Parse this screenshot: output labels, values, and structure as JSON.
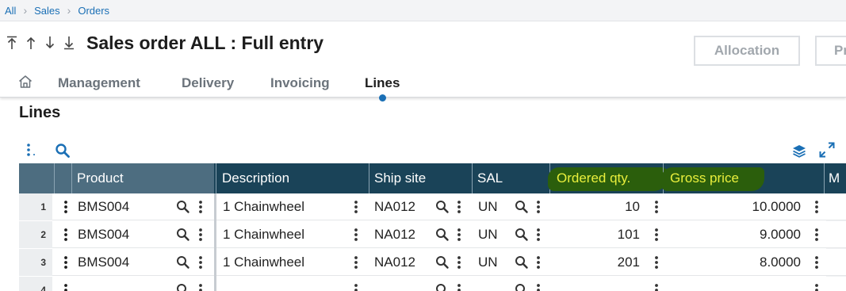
{
  "breadcrumb": [
    "All",
    "Sales",
    "Orders"
  ],
  "title": "Sales order ALL : Full entry",
  "actions": {
    "allocation": "Allocation",
    "next": "Pr"
  },
  "tabs": [
    {
      "label": "Management"
    },
    {
      "label": "Delivery"
    },
    {
      "label": "Invoicing"
    },
    {
      "label": "Lines",
      "active": true
    }
  ],
  "section": {
    "title": "Lines"
  },
  "grid": {
    "columns": {
      "product": "Product",
      "description": "Description",
      "ship_site": "Ship site",
      "sal": "SAL",
      "ordered_qty": "Ordered qty.",
      "gross_price": "Gross price",
      "more": "M"
    },
    "rows": [
      {
        "num": "1",
        "product": "BMS004",
        "description": "1 Chainwheel",
        "ship_site": "NA012",
        "sal": "UN",
        "ordered_qty": "10",
        "gross_price": "10.0000"
      },
      {
        "num": "2",
        "product": "BMS004",
        "description": "1 Chainwheel",
        "ship_site": "NA012",
        "sal": "UN",
        "ordered_qty": "101",
        "gross_price": "9.0000"
      },
      {
        "num": "3",
        "product": "BMS004",
        "description": "1 Chainwheel",
        "ship_site": "NA012",
        "sal": "UN",
        "ordered_qty": "201",
        "gross_price": "8.0000"
      },
      {
        "num": "4",
        "product": "",
        "description": "",
        "ship_site": "",
        "sal": "",
        "ordered_qty": "",
        "gross_price": ""
      }
    ]
  },
  "icons": {
    "nav": [
      "first-record-icon",
      "previous-record-icon",
      "next-record-icon",
      "last-record-icon"
    ],
    "home": "home-icon",
    "search": "search-icon",
    "more": "more-vertical-icon",
    "layers": "layers-icon",
    "expand": "expand-icon"
  },
  "colors": {
    "accent": "#1a6fb5",
    "grid_header": "#1a4358",
    "grid_header_fixed": "#4d6d80",
    "highlight_bg": "#2b5e0c",
    "highlight_text": "#e9ef3c"
  }
}
